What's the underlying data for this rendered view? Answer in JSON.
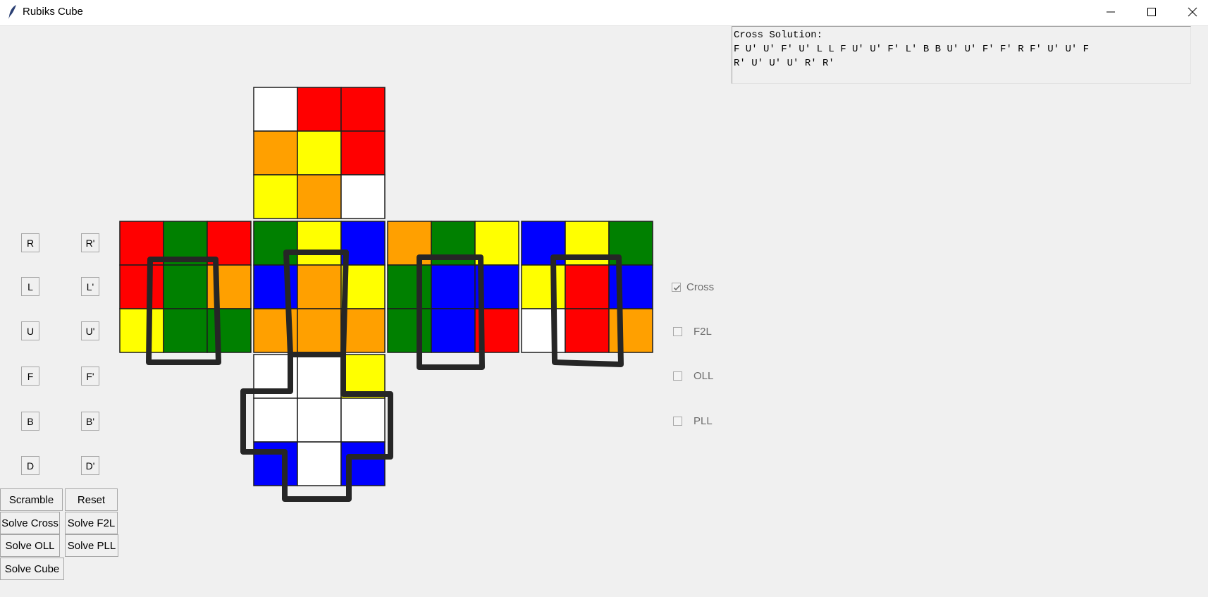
{
  "window": {
    "title": "Rubiks Cube"
  },
  "solution_panel": {
    "lines": [
      "Cross Solution:",
      "F U' U' F' U' L L F U' U' F' L' B B U' U' F' F' R F' U' U' F",
      "R' U' U' U' R' R'"
    ]
  },
  "move_buttons": [
    [
      "R",
      "R'"
    ],
    [
      "L",
      "L'"
    ],
    [
      "U",
      "U'"
    ],
    [
      "F",
      "F'"
    ],
    [
      "B",
      "B'"
    ],
    [
      "D",
      "D'"
    ]
  ],
  "action_buttons": {
    "scramble": "Scramble",
    "reset": "Reset",
    "solve_cross": "Solve Cross",
    "solve_f2l": "Solve F2L",
    "solve_oll": "Solve OLL",
    "solve_pll": "Solve PLL",
    "solve_cube": "Solve Cube"
  },
  "checkboxes": [
    {
      "label": "Cross",
      "checked": true
    },
    {
      "label": "F2L",
      "checked": false
    },
    {
      "label": "OLL",
      "checked": false
    },
    {
      "label": "PLL",
      "checked": false
    }
  ],
  "colors": {
    "W": "#ffffff",
    "R": "#ff0000",
    "O": "#ffa000",
    "Y": "#ffff00",
    "G": "#008000",
    "B": "#0000ff"
  },
  "cube_faces": {
    "up": [
      [
        "W",
        "R",
        "R"
      ],
      [
        "O",
        "Y",
        "R"
      ],
      [
        "Y",
        "O",
        "W"
      ]
    ],
    "left": [
      [
        "R",
        "G",
        "R"
      ],
      [
        "R",
        "G",
        "O"
      ],
      [
        "Y",
        "G",
        "G"
      ]
    ],
    "front": [
      [
        "G",
        "Y",
        "B"
      ],
      [
        "B",
        "O",
        "Y"
      ],
      [
        "O",
        "O",
        "O"
      ]
    ],
    "right": [
      [
        "O",
        "G",
        "Y"
      ],
      [
        "G",
        "B",
        "B"
      ],
      [
        "G",
        "B",
        "R"
      ]
    ],
    "back": [
      [
        "B",
        "Y",
        "G"
      ],
      [
        "Y",
        "R",
        "B"
      ],
      [
        "W",
        "R",
        "O"
      ]
    ],
    "down": [
      [
        "W",
        "W",
        "Y"
      ],
      [
        "W",
        "W",
        "W"
      ],
      [
        "B",
        "W",
        "B"
      ]
    ]
  }
}
